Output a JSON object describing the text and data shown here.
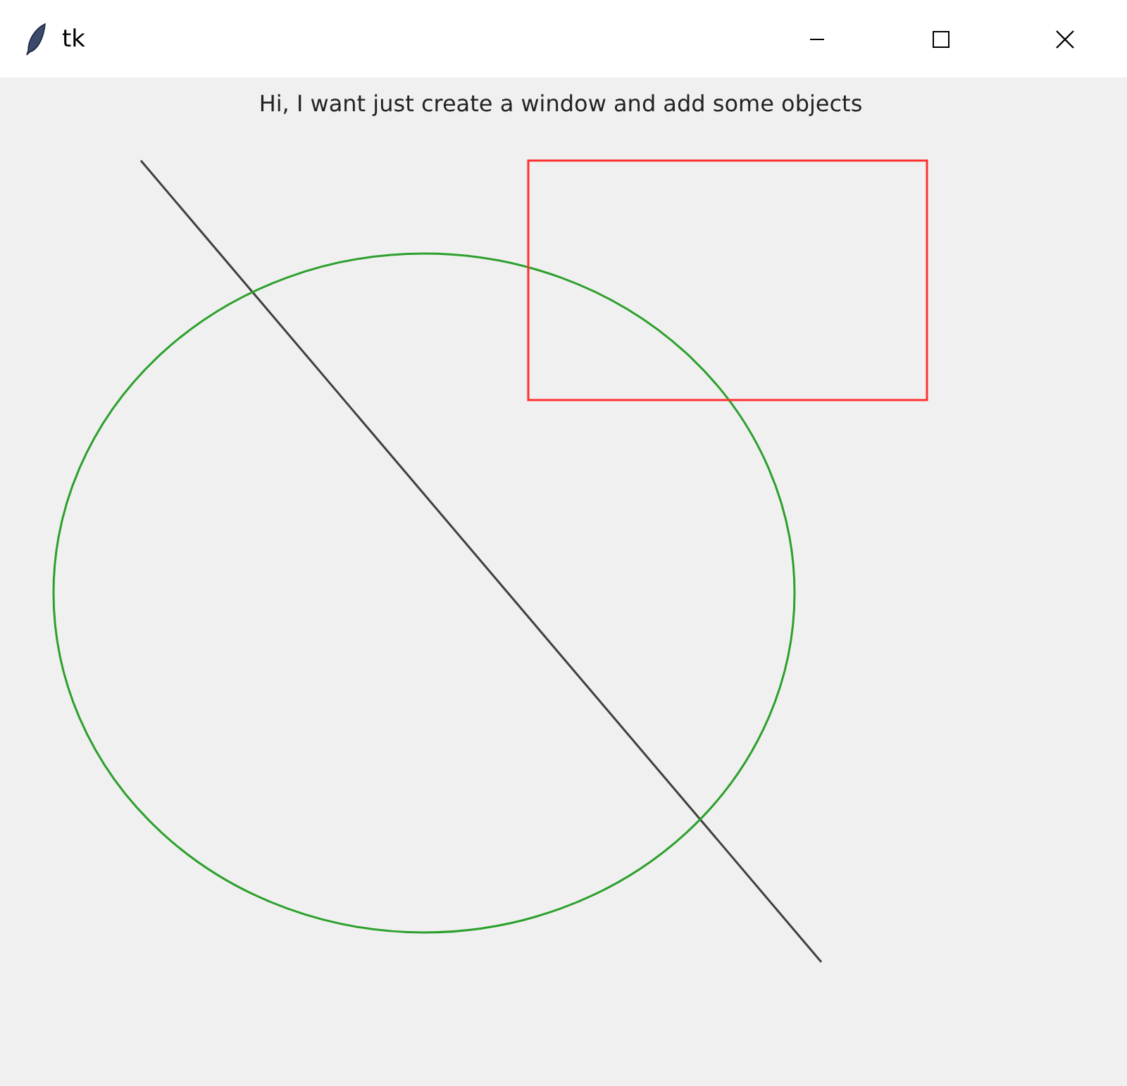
{
  "window": {
    "title": "tk"
  },
  "label": "Hi, I want just create a window and add some objects",
  "canvas": {
    "shapes": [
      {
        "kind": "line",
        "color": "#404040"
      },
      {
        "kind": "oval",
        "color": "#2ca02c"
      },
      {
        "kind": "rectangle",
        "color": "#ff3030"
      }
    ]
  }
}
